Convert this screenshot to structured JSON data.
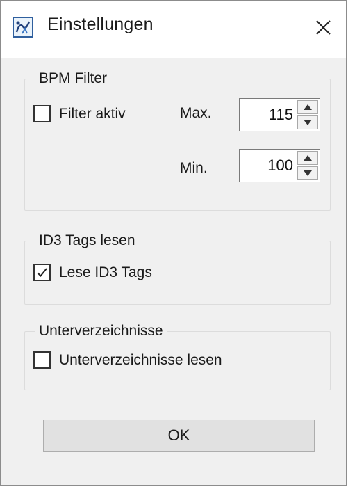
{
  "window": {
    "title": "Einstellungen",
    "icon": "app-icon",
    "close_icon": "close-icon"
  },
  "bpm_filter": {
    "title": "BPM Filter",
    "filter_active_label": "Filter aktiv",
    "filter_active_checked": false,
    "max_label": "Max.",
    "max_value": "115",
    "min_label": "Min.",
    "min_value": "100"
  },
  "id3": {
    "title": "ID3 Tags lesen",
    "read_label": "Lese ID3 Tags",
    "read_checked": true
  },
  "subdirs": {
    "title": "Unterverzeichnisse",
    "read_label": "Unterverzeichnisse lesen",
    "read_checked": false
  },
  "ok_label": "OK"
}
